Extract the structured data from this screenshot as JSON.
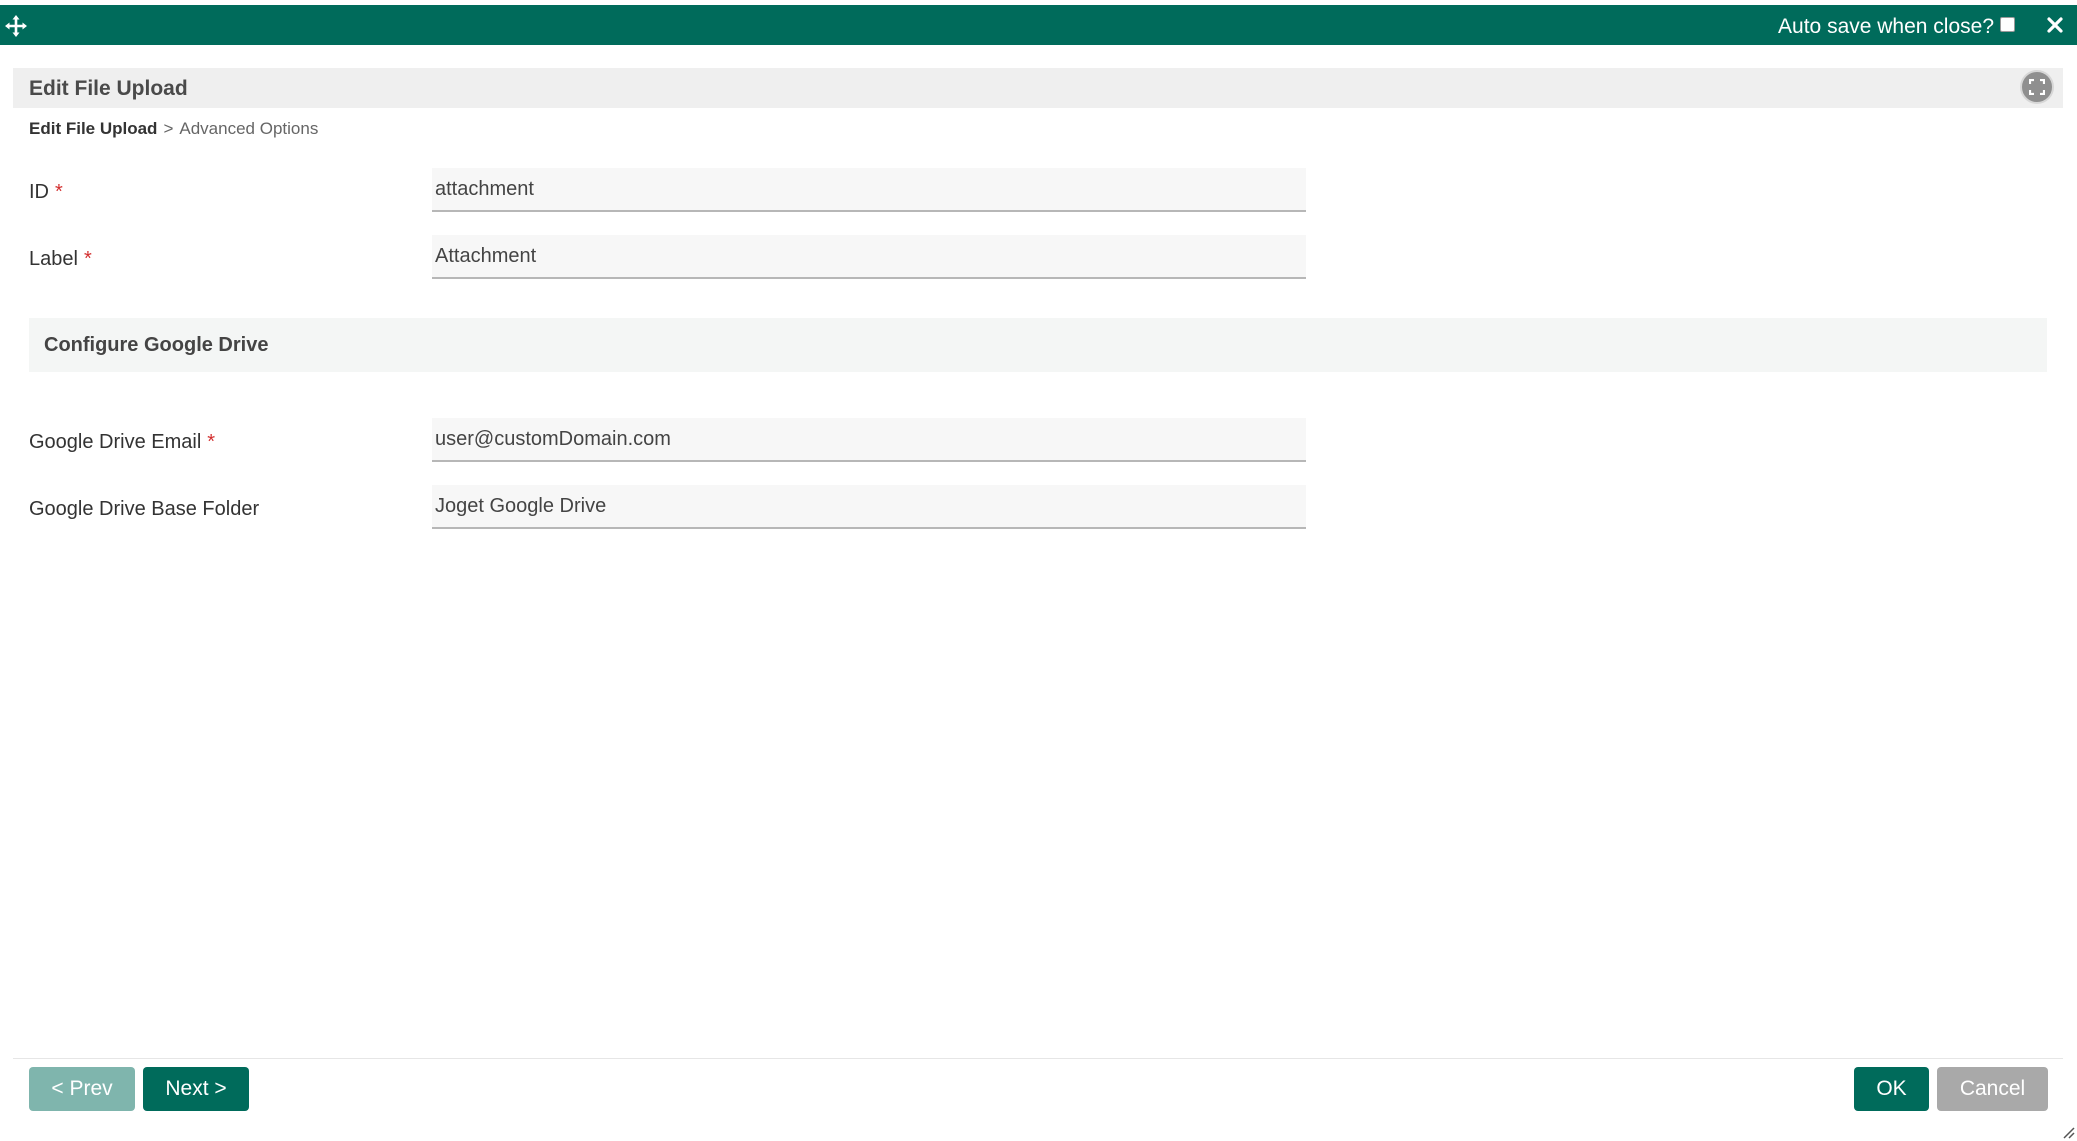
{
  "titlebar": {
    "autosave_label": "Auto save when close?",
    "autosave_checked": false,
    "accent_color": "#006b5b",
    "icons": [
      "move-icon",
      "close-icon"
    ]
  },
  "header": {
    "title": "Edit File Upload",
    "icons": [
      "fullscreen-icon"
    ]
  },
  "breadcrumb": {
    "current": "Edit File Upload",
    "separator": ">",
    "next": "Advanced Options"
  },
  "fields": {
    "id": {
      "label": "ID",
      "required_marker": "*",
      "value": "attachment"
    },
    "label": {
      "label": "Label",
      "required_marker": "*",
      "value": "Attachment"
    }
  },
  "section": {
    "title": "Configure Google Drive",
    "fields": {
      "email": {
        "label": "Google Drive Email",
        "required_marker": "*",
        "value": "user@customDomain.com"
      },
      "base_folder": {
        "label": "Google Drive Base Folder",
        "value": "Joget Google Drive"
      }
    }
  },
  "footer": {
    "prev_label": "< Prev",
    "next_label": "Next >",
    "ok_label": "OK",
    "cancel_label": "Cancel"
  }
}
